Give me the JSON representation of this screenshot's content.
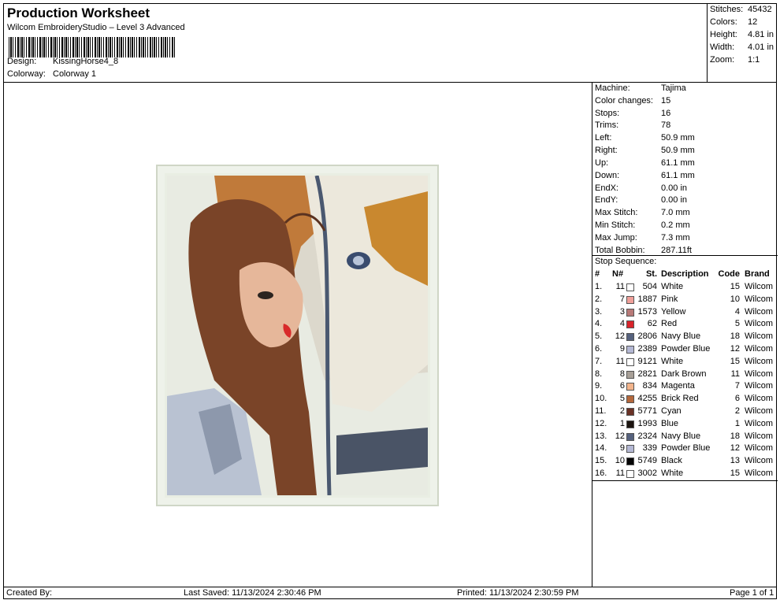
{
  "header": {
    "title": "Production Worksheet",
    "subtitle": "Wilcom EmbroideryStudio – Level 3 Advanced",
    "design_label": "Design:",
    "design_value": "KissingHorse4_8",
    "colorway_label": "Colorway:",
    "colorway_value": "Colorway 1"
  },
  "stats": [
    {
      "label": "Stitches:",
      "value": "45432"
    },
    {
      "label": "Colors:",
      "value": "12"
    },
    {
      "label": "Height:",
      "value": "4.81 in"
    },
    {
      "label": "Width:",
      "value": "4.01 in"
    },
    {
      "label": "Zoom:",
      "value": "1:1"
    }
  ],
  "machine_info": [
    {
      "label": "Machine:",
      "value": "Tajima"
    },
    {
      "label": "Color changes:",
      "value": "15"
    },
    {
      "label": "Stops:",
      "value": "16"
    },
    {
      "label": "Trims:",
      "value": "78"
    },
    {
      "label": "Left:",
      "value": "50.9 mm"
    },
    {
      "label": "Right:",
      "value": "50.9 mm"
    },
    {
      "label": "Up:",
      "value": "61.1 mm"
    },
    {
      "label": "Down:",
      "value": "61.1 mm"
    },
    {
      "label": "EndX:",
      "value": "0.00 in"
    },
    {
      "label": "EndY:",
      "value": "0.00 in"
    },
    {
      "label": "Max Stitch:",
      "value": "7.0 mm"
    },
    {
      "label": "Min Stitch:",
      "value": "0.2 mm"
    },
    {
      "label": "Max Jump:",
      "value": "7.3 mm"
    },
    {
      "label": "Total Bobbin:",
      "value": "287.11ft"
    }
  ],
  "stop_sequence": {
    "title": "Stop Sequence:",
    "headers": {
      "num": "#",
      "n": "N#",
      "st": "St.",
      "desc": "Description",
      "code": "Code",
      "brand": "Brand"
    },
    "rows": [
      {
        "num": "1.",
        "n": "11",
        "color": "#ffffff",
        "st": "504",
        "desc": "White",
        "code": "15",
        "brand": "Wilcom"
      },
      {
        "num": "2.",
        "n": "7",
        "color": "#f0a09a",
        "st": "1887",
        "desc": "Pink",
        "code": "10",
        "brand": "Wilcom"
      },
      {
        "num": "3.",
        "n": "3",
        "color": "#b87a78",
        "st": "1573",
        "desc": "Yellow",
        "code": "4",
        "brand": "Wilcom"
      },
      {
        "num": "4.",
        "n": "4",
        "color": "#d8232a",
        "st": "62",
        "desc": "Red",
        "code": "5",
        "brand": "Wilcom"
      },
      {
        "num": "5.",
        "n": "12",
        "color": "#56627e",
        "st": "2806",
        "desc": "Navy Blue",
        "code": "18",
        "brand": "Wilcom"
      },
      {
        "num": "6.",
        "n": "9",
        "color": "#b4b8d4",
        "st": "2389",
        "desc": "Powder Blue",
        "code": "12",
        "brand": "Wilcom"
      },
      {
        "num": "7.",
        "n": "11",
        "color": "#ffffff",
        "st": "9121",
        "desc": "White",
        "code": "15",
        "brand": "Wilcom"
      },
      {
        "num": "8.",
        "n": "8",
        "color": "#a8a098",
        "st": "2821",
        "desc": "Dark Brown",
        "code": "11",
        "brand": "Wilcom"
      },
      {
        "num": "9.",
        "n": "6",
        "color": "#f2b48c",
        "st": "834",
        "desc": "Magenta",
        "code": "7",
        "brand": "Wilcom"
      },
      {
        "num": "10.",
        "n": "5",
        "color": "#b4683c",
        "st": "4255",
        "desc": "Brick Red",
        "code": "6",
        "brand": "Wilcom"
      },
      {
        "num": "11.",
        "n": "2",
        "color": "#6a3226",
        "st": "5771",
        "desc": "Cyan",
        "code": "2",
        "brand": "Wilcom"
      },
      {
        "num": "12.",
        "n": "1",
        "color": "#1c1410",
        "st": "1993",
        "desc": "Blue",
        "code": "1",
        "brand": "Wilcom"
      },
      {
        "num": "13.",
        "n": "12",
        "color": "#56627e",
        "st": "2324",
        "desc": "Navy Blue",
        "code": "18",
        "brand": "Wilcom"
      },
      {
        "num": "14.",
        "n": "9",
        "color": "#b4b8d4",
        "st": "339",
        "desc": "Powder Blue",
        "code": "12",
        "brand": "Wilcom"
      },
      {
        "num": "15.",
        "n": "10",
        "color": "#050505",
        "st": "5749",
        "desc": "Black",
        "code": "13",
        "brand": "Wilcom"
      },
      {
        "num": "16.",
        "n": "11",
        "color": "#ffffff",
        "st": "3002",
        "desc": "White",
        "code": "15",
        "brand": "Wilcom"
      }
    ]
  },
  "footer": {
    "created_by": "Created By:",
    "last_saved": "Last Saved: 11/13/2024 2:30:46 PM",
    "printed": "Printed: 11/13/2024 2:30:59 PM",
    "page": "Page 1 of 1"
  }
}
